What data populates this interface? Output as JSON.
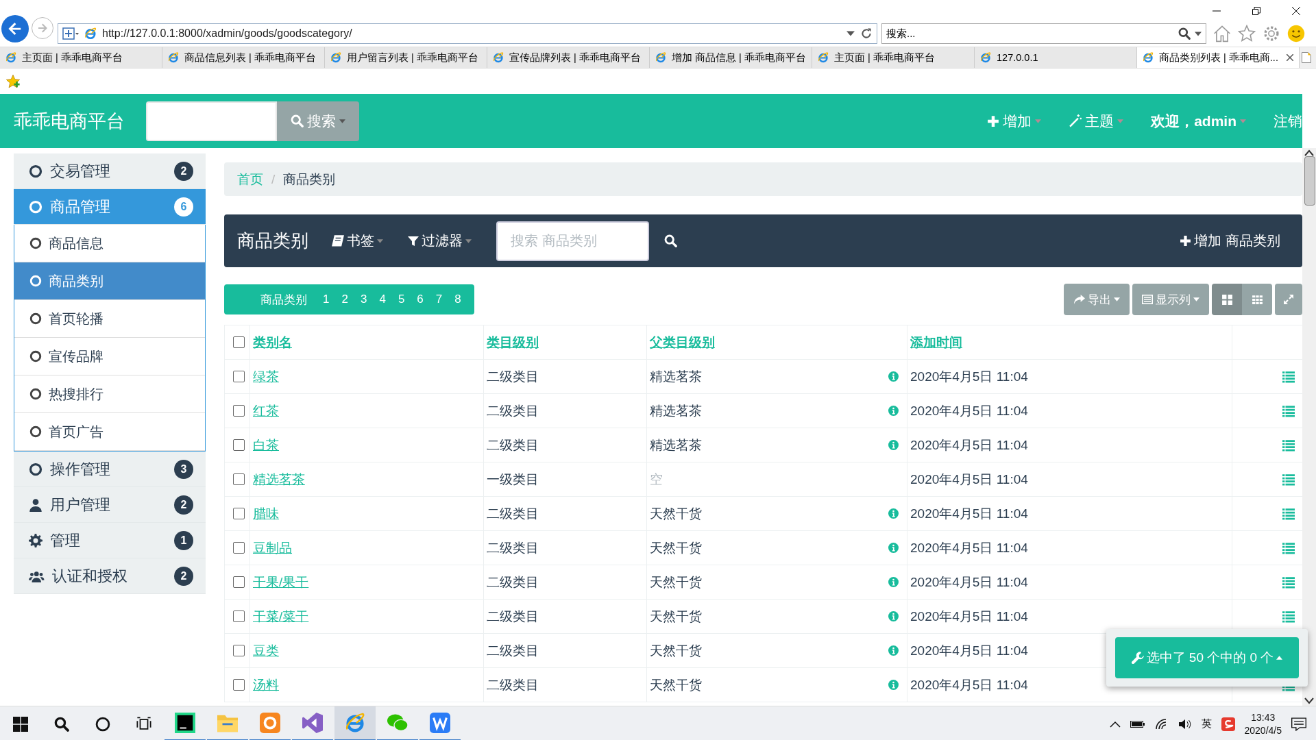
{
  "browser": {
    "url": "http://127.0.0.1:8000/xadmin/goods/goodscategory/",
    "search": "搜索...",
    "tabs": [
      {
        "label": "主页面 | 乖乖电商平台",
        "selected": false
      },
      {
        "label": "商品信息列表 | 乖乖电商平台",
        "selected": false
      },
      {
        "label": "用户留言列表 | 乖乖电商平台",
        "selected": false
      },
      {
        "label": "宣传品牌列表 | 乖乖电商平台",
        "selected": false
      },
      {
        "label": "增加 商品信息 | 乖乖电商平台",
        "selected": false
      },
      {
        "label": "主页面 | 乖乖电商平台",
        "selected": false
      },
      {
        "label": "127.0.0.1",
        "selected": false
      },
      {
        "label": "商品类别列表 | 乖乖电商...",
        "selected": true
      }
    ]
  },
  "header": {
    "brand": "乖乖电商平台",
    "search_button": "搜索",
    "nav": [
      {
        "kind": "add",
        "label": "增加"
      },
      {
        "kind": "theme",
        "label": "主题"
      },
      {
        "kind": "user",
        "label": "欢迎，admin"
      },
      {
        "kind": "logout",
        "label": "注销"
      }
    ]
  },
  "sidebar": {
    "items": [
      {
        "kind": "circle",
        "label": "交易管理",
        "badge": "2",
        "selected": false
      },
      {
        "kind": "circle",
        "label": "商品管理",
        "badge": "6",
        "selected": true,
        "expanded": true,
        "children": [
          {
            "label": "商品信息",
            "selected": false
          },
          {
            "label": "商品类别",
            "selected": true
          },
          {
            "label": "首页轮播",
            "selected": false
          },
          {
            "label": "宣传品牌",
            "selected": false
          },
          {
            "label": "热搜排行",
            "selected": false
          },
          {
            "label": "首页广告",
            "selected": false
          }
        ]
      },
      {
        "kind": "circle",
        "label": "操作管理",
        "badge": "3",
        "selected": false
      },
      {
        "kind": "user",
        "label": "用户管理",
        "badge": "2",
        "selected": false
      },
      {
        "kind": "gear",
        "label": "管理",
        "badge": "1",
        "selected": false
      },
      {
        "kind": "users",
        "label": "认证和授权",
        "badge": "2",
        "selected": false
      }
    ]
  },
  "breadcrumb": [
    "首页",
    "商品类别"
  ],
  "breadcrumb_separator": "/",
  "toolbar": {
    "title": "商品类别",
    "bookmark": "书签",
    "filter": "过滤器",
    "search_placeholder": "搜索 商品类别",
    "add": "增加 商品类别"
  },
  "levels": {
    "label": "商品类别",
    "pages": [
      "1",
      "2",
      "3",
      "4",
      "5",
      "6",
      "7",
      "8"
    ]
  },
  "actions": {
    "export": "导出",
    "columns": "显示列",
    "views": [
      {
        "kind": "cards",
        "selected": true
      },
      {
        "kind": "grid",
        "selected": false
      }
    ]
  },
  "table": {
    "columns": [
      "类别名",
      "类目级别",
      "父类目级别",
      "添加时间"
    ],
    "header_checked": false,
    "rows": [
      {
        "name": "绿茶",
        "level": "二级类目",
        "parent": "精选茗茶",
        "parent_empty": false,
        "time": "2020年4月5日 11:04",
        "checked": false
      },
      {
        "name": "红茶",
        "level": "二级类目",
        "parent": "精选茗茶",
        "parent_empty": false,
        "time": "2020年4月5日 11:04",
        "checked": false
      },
      {
        "name": "白茶",
        "level": "二级类目",
        "parent": "精选茗茶",
        "parent_empty": false,
        "time": "2020年4月5日 11:04",
        "checked": false
      },
      {
        "name": "精选茗茶",
        "level": "一级类目",
        "parent": "空",
        "parent_empty": true,
        "time": "2020年4月5日 11:04",
        "checked": false
      },
      {
        "name": "腊味",
        "level": "二级类目",
        "parent": "天然干货",
        "parent_empty": false,
        "time": "2020年4月5日 11:04",
        "checked": false
      },
      {
        "name": "豆制品",
        "level": "二级类目",
        "parent": "天然干货",
        "parent_empty": false,
        "time": "2020年4月5日 11:04",
        "checked": false
      },
      {
        "name": "干果/果干",
        "level": "二级类目",
        "parent": "天然干货",
        "parent_empty": false,
        "time": "2020年4月5日 11:04",
        "checked": false
      },
      {
        "name": "干菜/菜干",
        "level": "二级类目",
        "parent": "天然干货",
        "parent_empty": false,
        "time": "2020年4月5日 11:04",
        "checked": false
      },
      {
        "name": "豆类",
        "level": "二级类目",
        "parent": "天然干货",
        "parent_empty": false,
        "time": "2020年4月5日 11:04",
        "checked": false
      },
      {
        "name": "汤料",
        "level": "二级类目",
        "parent": "天然干货",
        "parent_empty": false,
        "time": "2020年4月5日 11:04",
        "checked": false
      }
    ]
  },
  "selection": {
    "label": "选中了 50 个中的 0 个"
  },
  "taskbar": {
    "apps": [
      {
        "kind": "pycharm",
        "selected": false
      },
      {
        "kind": "folder",
        "selected": false
      },
      {
        "kind": "browser-orange",
        "selected": false
      },
      {
        "kind": "visual-studio",
        "selected": false
      },
      {
        "kind": "ie",
        "selected": true
      },
      {
        "kind": "wechat",
        "selected": false
      },
      {
        "kind": "wps",
        "selected": false
      }
    ],
    "ime": "英",
    "time": "13:43",
    "date": "2020/4/5"
  }
}
